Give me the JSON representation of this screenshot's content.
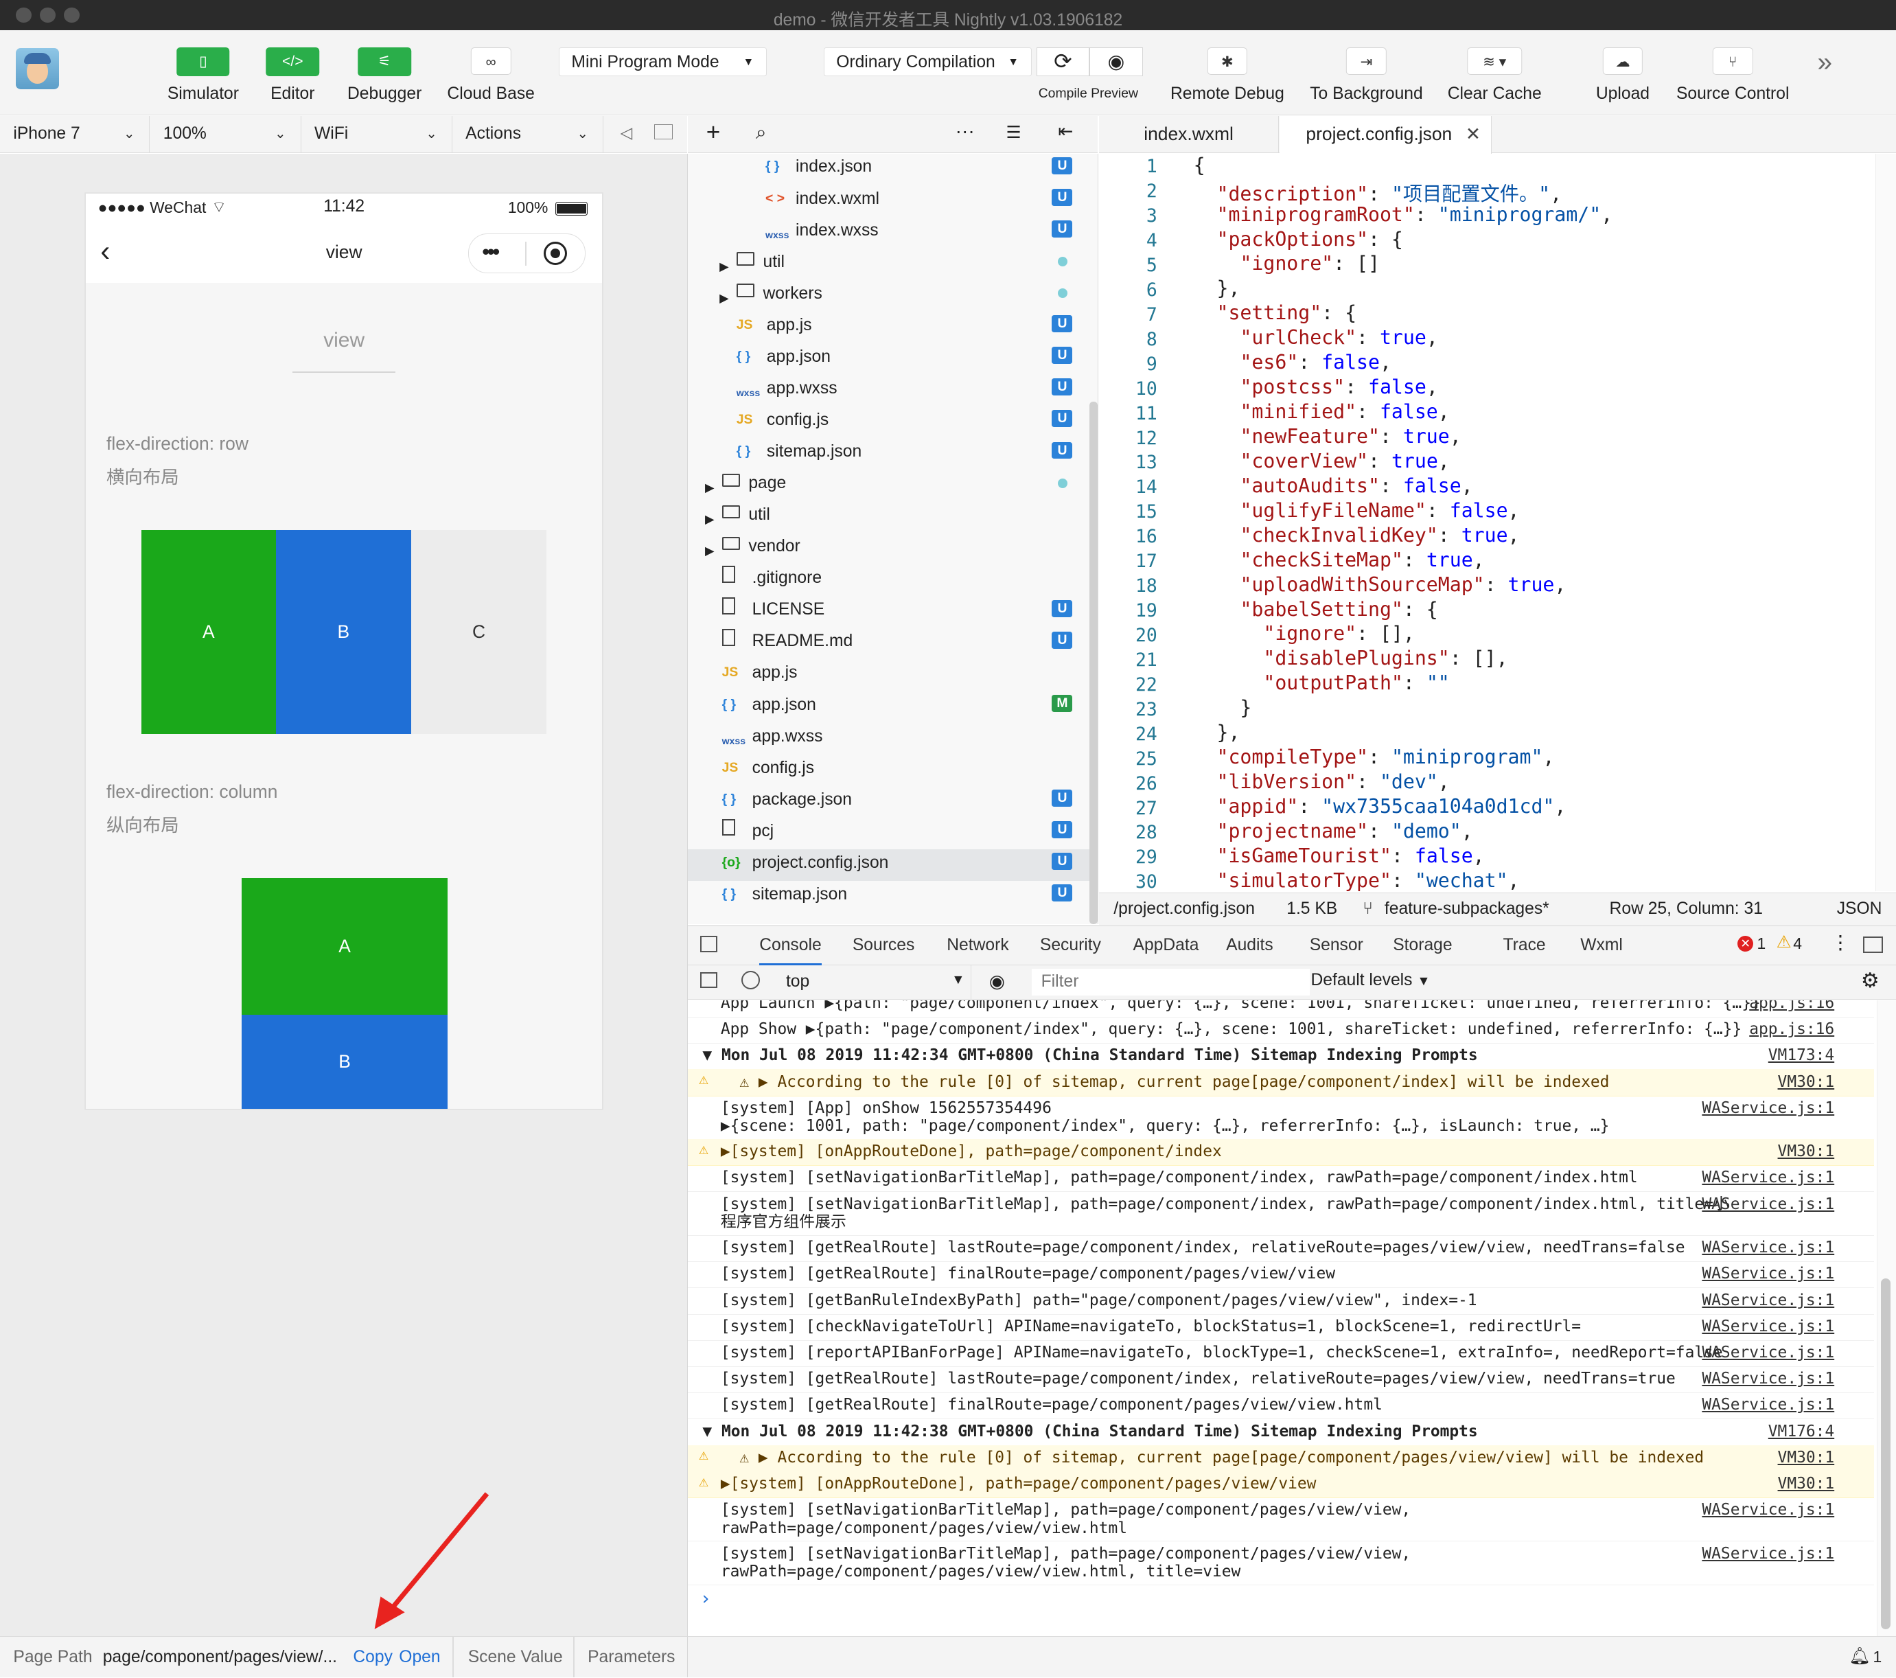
{
  "window_title": "demo - 微信开发者工具 Nightly v1.03.1906182",
  "toolbar": {
    "simulator": "Simulator",
    "editor": "Editor",
    "debugger": "Debugger",
    "cloud_base": "Cloud Base",
    "mode": "Mini Program Mode",
    "compilation": "Ordinary Compilation",
    "compile_preview": "Compile Preview",
    "remote_debug": "Remote Debug",
    "to_background": "To Background",
    "clear_cache": "Clear Cache",
    "upload": "Upload",
    "source_control": "Source Control",
    "more": "»"
  },
  "device_bar": {
    "device": "iPhone 7",
    "zoom": "100%",
    "network": "WiFi",
    "actions": "Actions"
  },
  "phone": {
    "carrier": "●●●●● WeChat",
    "time": "11:42",
    "battery": "100%",
    "nav_title": "view",
    "header_title": "view",
    "section1_title": "flex-direction: row",
    "section1_subtitle": "横向布局",
    "row_boxes": [
      "A",
      "B",
      "C"
    ],
    "section2_title": "flex-direction: column",
    "section2_subtitle": "纵向布局",
    "col_boxes": [
      "A",
      "B"
    ]
  },
  "page_path": {
    "label": "Page Path",
    "value": "page/component/pages/view/...",
    "copy": "Copy",
    "open": "Open",
    "scene_value": "Scene Value",
    "parameters": "Parameters"
  },
  "file_tree": [
    {
      "name": "index.json",
      "icon": "{ }",
      "badge": "U"
    },
    {
      "name": "index.wxml",
      "icon": "< >",
      "badge": "U"
    },
    {
      "name": "index.wxss",
      "icon": "wxss",
      "badge": "U"
    },
    {
      "name": "util",
      "icon": "folder",
      "badge": "dot"
    },
    {
      "name": "workers",
      "icon": "folder",
      "badge": "dot"
    },
    {
      "name": "app.js",
      "icon": "JS",
      "badge": "U"
    },
    {
      "name": "app.json",
      "icon": "{ }",
      "badge": "U"
    },
    {
      "name": "app.wxss",
      "icon": "wxss",
      "badge": "U"
    },
    {
      "name": "config.js",
      "icon": "JS",
      "badge": "U"
    },
    {
      "name": "sitemap.json",
      "icon": "{ }",
      "badge": "U"
    },
    {
      "name": "page",
      "icon": "folder",
      "badge": "dot"
    },
    {
      "name": "util",
      "icon": "folder",
      "badge": ""
    },
    {
      "name": "vendor",
      "icon": "folder",
      "badge": ""
    },
    {
      "name": ".gitignore",
      "icon": "file",
      "badge": ""
    },
    {
      "name": "LICENSE",
      "icon": "file",
      "badge": "U"
    },
    {
      "name": "README.md",
      "icon": "file",
      "badge": "U"
    },
    {
      "name": "app.js",
      "icon": "JS",
      "badge": ""
    },
    {
      "name": "app.json",
      "icon": "{ }",
      "badge": "M"
    },
    {
      "name": "app.wxss",
      "icon": "wxss",
      "badge": ""
    },
    {
      "name": "config.js",
      "icon": "JS",
      "badge": ""
    },
    {
      "name": "package.json",
      "icon": "{ }",
      "badge": "U"
    },
    {
      "name": "pcj",
      "icon": "file",
      "badge": "U"
    },
    {
      "name": "project.config.json",
      "icon": "{o}",
      "badge": "U"
    },
    {
      "name": "sitemap.json",
      "icon": "{ }",
      "badge": "U"
    }
  ],
  "editor_tabs": [
    "index.wxml",
    "project.config.json"
  ],
  "code_lines": [
    "{",
    "  \"description\": \"项目配置文件。\",",
    "  \"miniprogramRoot\": \"miniprogram/\",",
    "  \"packOptions\": {",
    "    \"ignore\": []",
    "  },",
    "  \"setting\": {",
    "    \"urlCheck\": true,",
    "    \"es6\": false,",
    "    \"postcss\": false,",
    "    \"minified\": false,",
    "    \"newFeature\": true,",
    "    \"coverView\": true,",
    "    \"autoAudits\": false,",
    "    \"uglifyFileName\": false,",
    "    \"checkInvalidKey\": true,",
    "    \"checkSiteMap\": true,",
    "    \"uploadWithSourceMap\": true,",
    "    \"babelSetting\": {",
    "      \"ignore\": [],",
    "      \"disablePlugins\": [],",
    "      \"outputPath\": \"\"",
    "    }",
    "  },",
    "  \"compileType\": \"miniprogram\",",
    "  \"libVersion\": \"dev\",",
    "  \"appid\": \"wx7355caa104a0d1cd\",",
    "  \"projectname\": \"demo\",",
    "  \"isGameTourist\": false,",
    "  \"simulatorType\": \"wechat\","
  ],
  "editor_status": {
    "path": "/project.config.json",
    "size": "1.5 KB",
    "branch": "feature-subpackages*",
    "position": "Row 25, Column: 31",
    "lang": "JSON"
  },
  "devtools_tabs": [
    "Console",
    "Sources",
    "Network",
    "Security",
    "AppData",
    "Audits",
    "Sensor",
    "Storage",
    "Trace",
    "Wxml"
  ],
  "devtools_counts": {
    "errors": "1",
    "warnings": "4"
  },
  "console_filter": {
    "context": "top",
    "placeholder": "Filter",
    "levels": "Default levels"
  },
  "console_rows": [
    {
      "text": "App Launch ▶{path: \"page/component/index\", query: {…}, scene: 1001, shareTicket: undefined, referrerInfo: {…}}",
      "src": "app.js:16",
      "type": "log"
    },
    {
      "text": "App Show ▶{path: \"page/component/index\", query: {…}, scene: 1001, shareTicket: undefined, referrerInfo: {…}}",
      "src": "app.js:16",
      "type": "log"
    },
    {
      "text": "▼ Mon Jul 08 2019 11:42:34 GMT+0800 (China Standard Time) Sitemap Indexing Prompts",
      "src": "VM173:4",
      "type": "group"
    },
    {
      "text": "  ⚠ ▶ According to the rule [0] of sitemap, current page[page/component/index] will be indexed",
      "src": "VM30:1",
      "type": "warn"
    },
    {
      "text": "[system] [App] onShow 1562557354496\n▶{scene: 1001, path: \"page/component/index\", query: {…}, referrerInfo: {…}, isLaunch: true, …}",
      "src": "WAService.js:1",
      "type": "log"
    },
    {
      "text": "▶[system] [onAppRouteDone], path=page/component/index",
      "src": "VM30:1",
      "type": "warn"
    },
    {
      "text": "[system] [setNavigationBarTitleMap], path=page/component/index, rawPath=page/component/index.html",
      "src": "WAService.js:1",
      "type": "log"
    },
    {
      "text": "[system] [setNavigationBarTitleMap], path=page/component/index, rawPath=page/component/index.html, title=小\n程序官方组件展示",
      "src": "WAService.js:1",
      "type": "log"
    },
    {
      "text": "[system] [getRealRoute] lastRoute=page/component/index, relativeRoute=pages/view/view, needTrans=false",
      "src": "WAService.js:1",
      "type": "log"
    },
    {
      "text": "[system] [getRealRoute] finalRoute=page/component/pages/view/view",
      "src": "WAService.js:1",
      "type": "log"
    },
    {
      "text": "[system] [getBanRuleIndexByPath] path=\"page/component/pages/view/view\", index=-1",
      "src": "WAService.js:1",
      "type": "log"
    },
    {
      "text": "[system] [checkNavigateToUrl] APIName=navigateTo, blockStatus=1, blockScene=1, redirectUrl=",
      "src": "WAService.js:1",
      "type": "log"
    },
    {
      "text": "[system] [reportAPIBanForPage] APIName=navigateTo, blockType=1, checkScene=1, extraInfo=, needReport=false",
      "src": "WAService.js:1",
      "type": "log"
    },
    {
      "text": "[system] [getRealRoute] lastRoute=page/component/index, relativeRoute=pages/view/view, needTrans=true",
      "src": "WAService.js:1",
      "type": "log"
    },
    {
      "text": "[system] [getRealRoute] finalRoute=page/component/pages/view/view.html",
      "src": "WAService.js:1",
      "type": "log"
    },
    {
      "text": "▼ Mon Jul 08 2019 11:42:38 GMT+0800 (China Standard Time) Sitemap Indexing Prompts",
      "src": "VM176:4",
      "type": "group"
    },
    {
      "text": "  ⚠ ▶ According to the rule [0] of sitemap, current page[page/component/pages/view/view] will be indexed",
      "src": "VM30:1",
      "type": "warn"
    },
    {
      "text": "▶[system] [onAppRouteDone], path=page/component/pages/view/view",
      "src": "VM30:1",
      "type": "warn"
    },
    {
      "text": "[system] [setNavigationBarTitleMap], path=page/component/pages/view/view,\nrawPath=page/component/pages/view/view.html",
      "src": "WAService.js:1",
      "type": "log"
    },
    {
      "text": "[system] [setNavigationBarTitleMap], path=page/component/pages/view/view,\nrawPath=page/component/pages/view/view.html, title=view",
      "src": "WAService.js:1",
      "type": "log"
    }
  ],
  "console_prompt": "›",
  "notif_count": "1",
  "colors": {
    "green": "#1aa81a",
    "blue": "#1f6fd6",
    "accent_green": "#2aae4a",
    "string": "#a31515",
    "key": "#a31515",
    "keyword": "#0000ff",
    "link": "#1f6fd6"
  }
}
